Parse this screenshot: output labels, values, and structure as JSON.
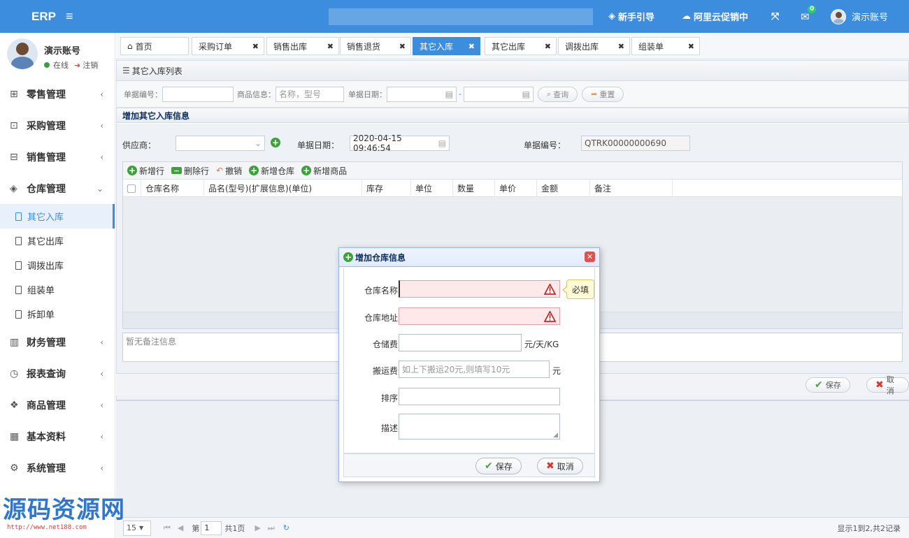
{
  "topbar": {
    "brand": "ERP",
    "menu_icon": "≡",
    "guide": "新手引导",
    "promo": "阿里云促销中",
    "mail_count": "0",
    "account": "演示账号"
  },
  "user": {
    "name": "演示账号",
    "status": "在线",
    "logout": "注销"
  },
  "sidebar": {
    "items": [
      {
        "label": "零售管理",
        "icon": "gift-icon"
      },
      {
        "label": "采购管理",
        "icon": "cart-icon"
      },
      {
        "label": "销售管理",
        "icon": "briefcase-icon"
      },
      {
        "label": "仓库管理",
        "icon": "layers-icon"
      },
      {
        "label": "财务管理",
        "icon": "book-icon"
      },
      {
        "label": "报表查询",
        "icon": "clock-icon"
      },
      {
        "label": "商品管理",
        "icon": "box-icon"
      },
      {
        "label": "基本资料",
        "icon": "grid-icon"
      },
      {
        "label": "系统管理",
        "icon": "gear-icon"
      }
    ],
    "warehouse_sub": [
      "其它入库",
      "其它出库",
      "调拨出库",
      "组装单",
      "拆卸单"
    ]
  },
  "tabs": [
    "首页",
    "采购订单",
    "销售出库",
    "销售退货",
    "其它入库",
    "其它出库",
    "调拨出库",
    "组装单"
  ],
  "list_panel": {
    "title": "其它入库列表",
    "bill_no_label": "单据编号：",
    "goods_label": "商品信息：",
    "goods_placeholder": "名称，型号",
    "date_label": "单据日期：",
    "search_btn": "查询",
    "reset_btn": "重置"
  },
  "add_panel": {
    "title": "增加其它入库信息",
    "supplier_label": "供应商：",
    "date_label": "单据日期：",
    "date_value": "2020-04-15 09:46:54",
    "bill_no_label": "单据编号：",
    "bill_no_value": "QTRK00000000690",
    "toolbar": [
      "新增行",
      "删除行",
      "撤销",
      "新增仓库",
      "新增商品"
    ],
    "columns": [
      "仓库名称",
      "品名(型号)(扩展信息)(单位)",
      "库存",
      "单位",
      "数量",
      "单价",
      "金额",
      "备注"
    ],
    "remark_placeholder": "暂无备注信息",
    "save": "保存",
    "cancel": "取消"
  },
  "pager": {
    "page_size": "15",
    "page_prefix": "第",
    "page": "1",
    "total_pages": "共1页",
    "summary": "显示1到2,共2记录"
  },
  "modal": {
    "title": "增加仓库信息",
    "name_label": "仓库名称",
    "address_label": "仓库地址",
    "storage_fee_label": "仓储费",
    "storage_unit": "元/天/KG",
    "handling_fee_label": "搬运费",
    "handling_placeholder": "如上下搬运20元,则填写10元",
    "handling_unit": "元",
    "sort_label": "排序",
    "desc_label": "描述",
    "required_tip": "必填",
    "save": "保存",
    "cancel": "取消"
  },
  "watermark": {
    "text": "源码资源网",
    "url": "http://www.net188.com"
  },
  "colors": {
    "primary": "#3c8dde",
    "invalid_bg": "#fde8ea",
    "green": "#3aa337",
    "danger": "#d9534f"
  }
}
